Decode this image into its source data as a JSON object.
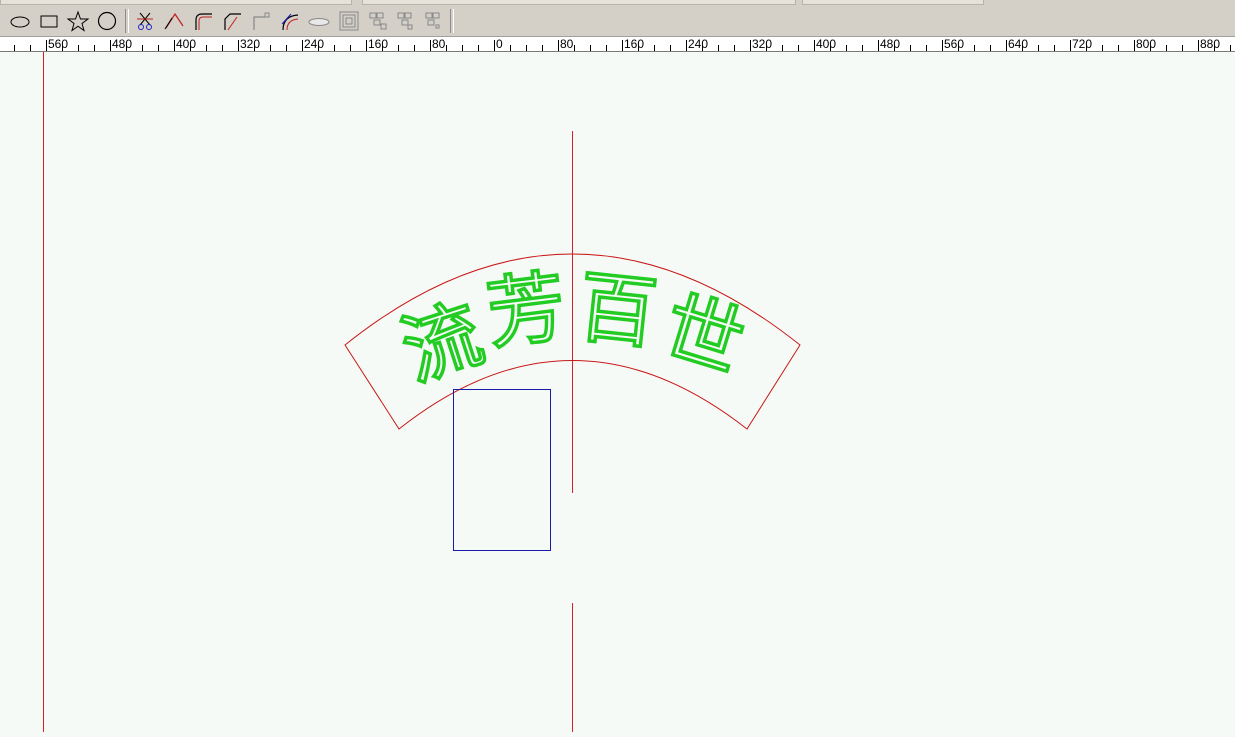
{
  "toolbar": {
    "buttons": [
      {
        "name": "ellipse-tool-button",
        "icon": "ellipse-icon"
      },
      {
        "name": "rectangle-tool-button",
        "icon": "rectangle-icon"
      },
      {
        "name": "star-tool-button",
        "icon": "star-icon"
      },
      {
        "name": "polygon-tool-button",
        "icon": "octagon-icon"
      },
      {
        "name": "cut-tool-button",
        "icon": "scissors-icon"
      },
      {
        "name": "line-cut-tool-button",
        "icon": "angle-line-icon"
      },
      {
        "name": "round-corner-tool-button",
        "icon": "round-corner-icon"
      },
      {
        "name": "chamfer-corner-tool-button",
        "icon": "chamfer-corner-icon"
      },
      {
        "name": "inner-corner-tool-button",
        "icon": "inner-corner-icon"
      },
      {
        "name": "arc-fillet-tool-button",
        "icon": "arc-fillet-icon"
      },
      {
        "name": "oval-stroke-tool-button",
        "icon": "flat-ellipse-icon"
      },
      {
        "name": "offset-contour-tool-button",
        "icon": "concentric-squares-icon"
      },
      {
        "name": "align-objects-a-button",
        "icon": "grouped-squares-icon"
      },
      {
        "name": "align-objects-b-button",
        "icon": "grouped-squares-icon"
      },
      {
        "name": "align-objects-c-button",
        "icon": "grouped-squares-icon"
      }
    ]
  },
  "ruler": {
    "labels": [
      "560",
      "480",
      "400",
      "320",
      "240",
      "160",
      "80",
      "0",
      "80",
      "160",
      "240",
      "320",
      "400",
      "480",
      "560",
      "640",
      "720",
      "800",
      "880"
    ]
  },
  "canvas": {
    "text_characters": [
      "流",
      "芳",
      "百",
      "世"
    ],
    "colors": {
      "guide_line": "#d42020",
      "arc_shape": "#c81818",
      "text_outline": "#22cc22",
      "rectangle": "#1a1aa8",
      "background": "#f6faf6"
    }
  }
}
